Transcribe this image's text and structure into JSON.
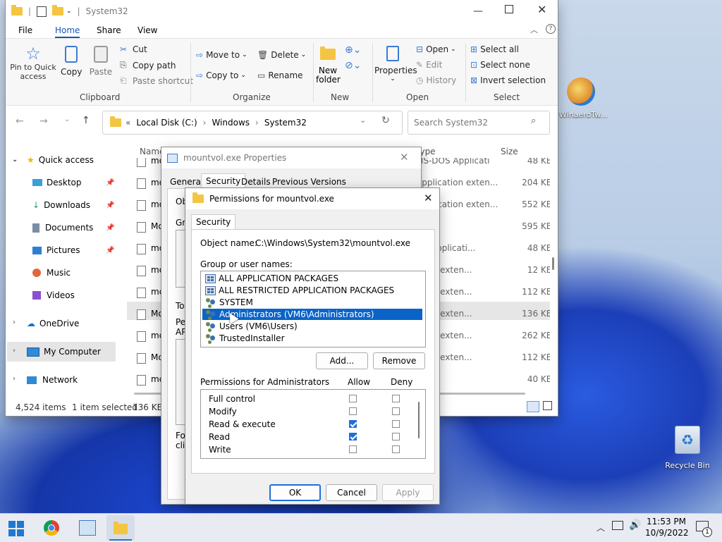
{
  "explorer": {
    "title": "System32",
    "menu": {
      "file": "File",
      "home": "Home",
      "share": "Share",
      "view": "View"
    },
    "ribbon": {
      "pin": "Pin to Quick access",
      "copy": "Copy",
      "paste": "Paste",
      "cut": "Cut",
      "copy_path": "Copy path",
      "paste_shortcut": "Paste shortcut",
      "clipboard": "Clipboard",
      "move_to": "Move to",
      "copy_to": "Copy to",
      "delete": "Delete",
      "rename": "Rename",
      "organize": "Organize",
      "new_folder": "New folder",
      "new": "New",
      "properties": "Properties",
      "open": "Open",
      "edit": "Edit",
      "history": "History",
      "open_group": "Open",
      "select_all": "Select all",
      "select_none": "Select none",
      "invert_selection": "Invert selection",
      "select": "Select"
    },
    "address": {
      "p1": "Local Disk (C:)",
      "p2": "Windows",
      "p3": "System32"
    },
    "search_placeholder": "Search System32",
    "nav": {
      "quick_access": "Quick access",
      "desktop": "Desktop",
      "downloads": "Downloads",
      "documents": "Documents",
      "pictures": "Pictures",
      "music": "Music",
      "videos": "Videos",
      "onedrive": "OneDrive",
      "my_computer": "My Computer",
      "network": "Network"
    },
    "columns": {
      "name": "Name",
      "type": "Type",
      "size": "Size"
    },
    "files": [
      {
        "name": "mo",
        "type": "MS-DOS Applicati",
        "size": "48 KB"
      },
      {
        "name": "moc",
        "type": "Application exten...",
        "size": "204 KB"
      },
      {
        "name": "moc",
        "type": "Application exten...",
        "size": "552 KB"
      },
      {
        "name": "MoN",
        "type": "ation",
        "size": "595 KB"
      },
      {
        "name": "mor",
        "type": "OS Applicati...",
        "size": "48 KB"
      },
      {
        "name": "mor",
        "type": "ation exten...",
        "size": "12 KB"
      },
      {
        "name": "mos",
        "type": "ation exten...",
        "size": "112 KB"
      },
      {
        "name": "Mos",
        "type": "ation exten...",
        "size": "136 KB"
      },
      {
        "name": "mos",
        "type": "ation exten...",
        "size": "262 KB"
      },
      {
        "name": "Mos",
        "type": "ation exten...",
        "size": "112 KB"
      },
      {
        "name": "mou",
        "type": "ation",
        "size": "40 KB"
      }
    ],
    "status": {
      "items": "4,524 items",
      "selected": "1 item selected",
      "size": "136 KB"
    }
  },
  "properties": {
    "title": "mountvol.exe Properties",
    "tabs": {
      "general": "General",
      "security": "Security",
      "details": "Details",
      "previous": "Previous Versions"
    },
    "frag": {
      "ob": "Ob",
      "gro": "Gro",
      "to": "To",
      "pe": "Pe",
      "ap": "AP",
      "for": "For",
      "clic": "clic"
    }
  },
  "permissions": {
    "title": "Permissions for mountvol.exe",
    "tab": "Security",
    "object_label": "Object name:",
    "object_value": "C:\\Windows\\System32\\mountvol.exe",
    "group_label": "Group or user names:",
    "groups": [
      {
        "name": "ALL APPLICATION PACKAGES",
        "icon": "package-icon"
      },
      {
        "name": "ALL RESTRICTED APPLICATION PACKAGES",
        "icon": "package-icon"
      },
      {
        "name": "SYSTEM",
        "icon": "users-icon"
      },
      {
        "name": "Administrators (VM6\\Administrators)",
        "icon": "users-icon"
      },
      {
        "name": "Users (VM6\\Users)",
        "icon": "users-icon"
      },
      {
        "name": "TrustedInstaller",
        "icon": "users-icon"
      }
    ],
    "add": "Add...",
    "remove": "Remove",
    "perm_header": "Permissions for Administrators",
    "allow": "Allow",
    "deny": "Deny",
    "perms": [
      {
        "name": "Full control",
        "allow": false,
        "deny": false
      },
      {
        "name": "Modify",
        "allow": false,
        "deny": false
      },
      {
        "name": "Read & execute",
        "allow": true,
        "deny": false
      },
      {
        "name": "Read",
        "allow": true,
        "deny": false
      },
      {
        "name": "Write",
        "allow": false,
        "deny": false
      }
    ],
    "ok": "OK",
    "cancel": "Cancel",
    "apply": "Apply"
  },
  "desktop": {
    "winaero": "WinaeroTw...",
    "recycle": "Recycle Bin"
  },
  "taskbar": {
    "time": "11:53 PM",
    "date": "10/9/2022",
    "notif": "1"
  }
}
